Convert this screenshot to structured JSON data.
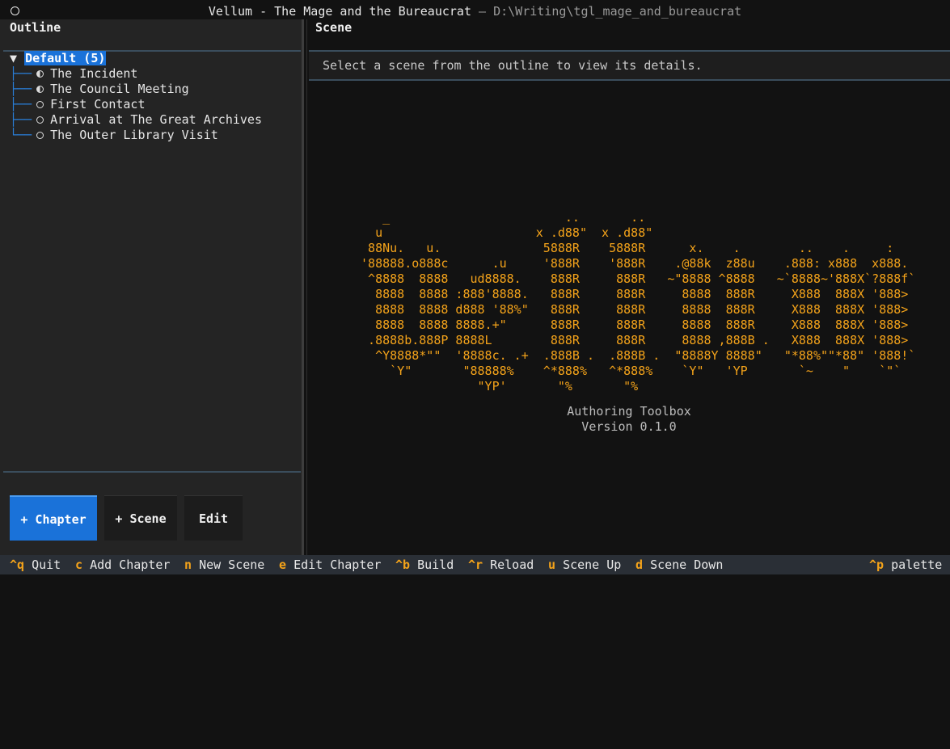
{
  "window": {
    "title": "Vellum - The Mage and the Bureaucrat",
    "separator": "–",
    "path": "D:\\Writing\\tgl_mage_and_bureaucrat"
  },
  "outline": {
    "title": "Outline",
    "root": {
      "expander": "▼",
      "label": "Default (5)"
    },
    "items": [
      {
        "label": "The Incident",
        "status": "half"
      },
      {
        "label": "The Council Meeting",
        "status": "half"
      },
      {
        "label": "First Contact",
        "status": "empty"
      },
      {
        "label": "Arrival at The Great Archives",
        "status": "empty"
      },
      {
        "label": "The Outer Library Visit",
        "status": "empty"
      }
    ]
  },
  "buttons": {
    "chapter": "+ Chapter",
    "scene": "+ Scene",
    "edit": "Edit"
  },
  "scene": {
    "title": "Scene",
    "message": "Select a scene from the outline to view its details.",
    "ascii_art": "    _                        ..       ..\n   u                     x .d88\"  x .d88\"\n  88Nu.   u.              5888R    5888R      x.    .        ..    .     :\n '88888.o888c      .u     '888R    '888R    .@88k  z88u    .888: x888  x888.\n  ^8888  8888   ud8888.    888R     888R   ~\"8888 ^8888   ~`8888~'888X`?888f`\n   8888  8888 :888'8888.   888R     888R     8888  888R     X888  888X '888>\n   8888  8888 d888 '88%\"   888R     888R     8888  888R     X888  888X '888>\n   8888  8888 8888.+\"      888R     888R     8888  888R     X888  888X '888>\n  .8888b.888P 8888L        888R     888R     8888 ,888B .   X888  888X '888>\n   ^Y8888*\"\"  '8888c. .+  .888B .  .888B .  \"8888Y 8888\"   \"*88%\"\"*88\" '888!`\n     `Y\"       \"88888%    ^*888%   ^*888%    `Y\"   'YP       `~    \"    `\"`\n                 \"YP'       \"%       \"%",
    "app_name": "Authoring Toolbox",
    "version": "Version 0.1.0"
  },
  "statusbar": {
    "items": [
      {
        "key": "^q",
        "label": "Quit"
      },
      {
        "key": "c",
        "label": "Add Chapter"
      },
      {
        "key": "n",
        "label": "New Scene"
      },
      {
        "key": "e",
        "label": "Edit Chapter"
      },
      {
        "key": "^b",
        "label": "Build"
      },
      {
        "key": "^r",
        "label": "Reload"
      },
      {
        "key": "u",
        "label": "Scene Up"
      },
      {
        "key": "d",
        "label": "Scene Down"
      }
    ],
    "palette": {
      "key": "^p",
      "label": "palette"
    }
  },
  "colors": {
    "accent": "#1a72d9",
    "key_highlight": "#f4a31a",
    "ascii_art": "#f4a31a"
  }
}
